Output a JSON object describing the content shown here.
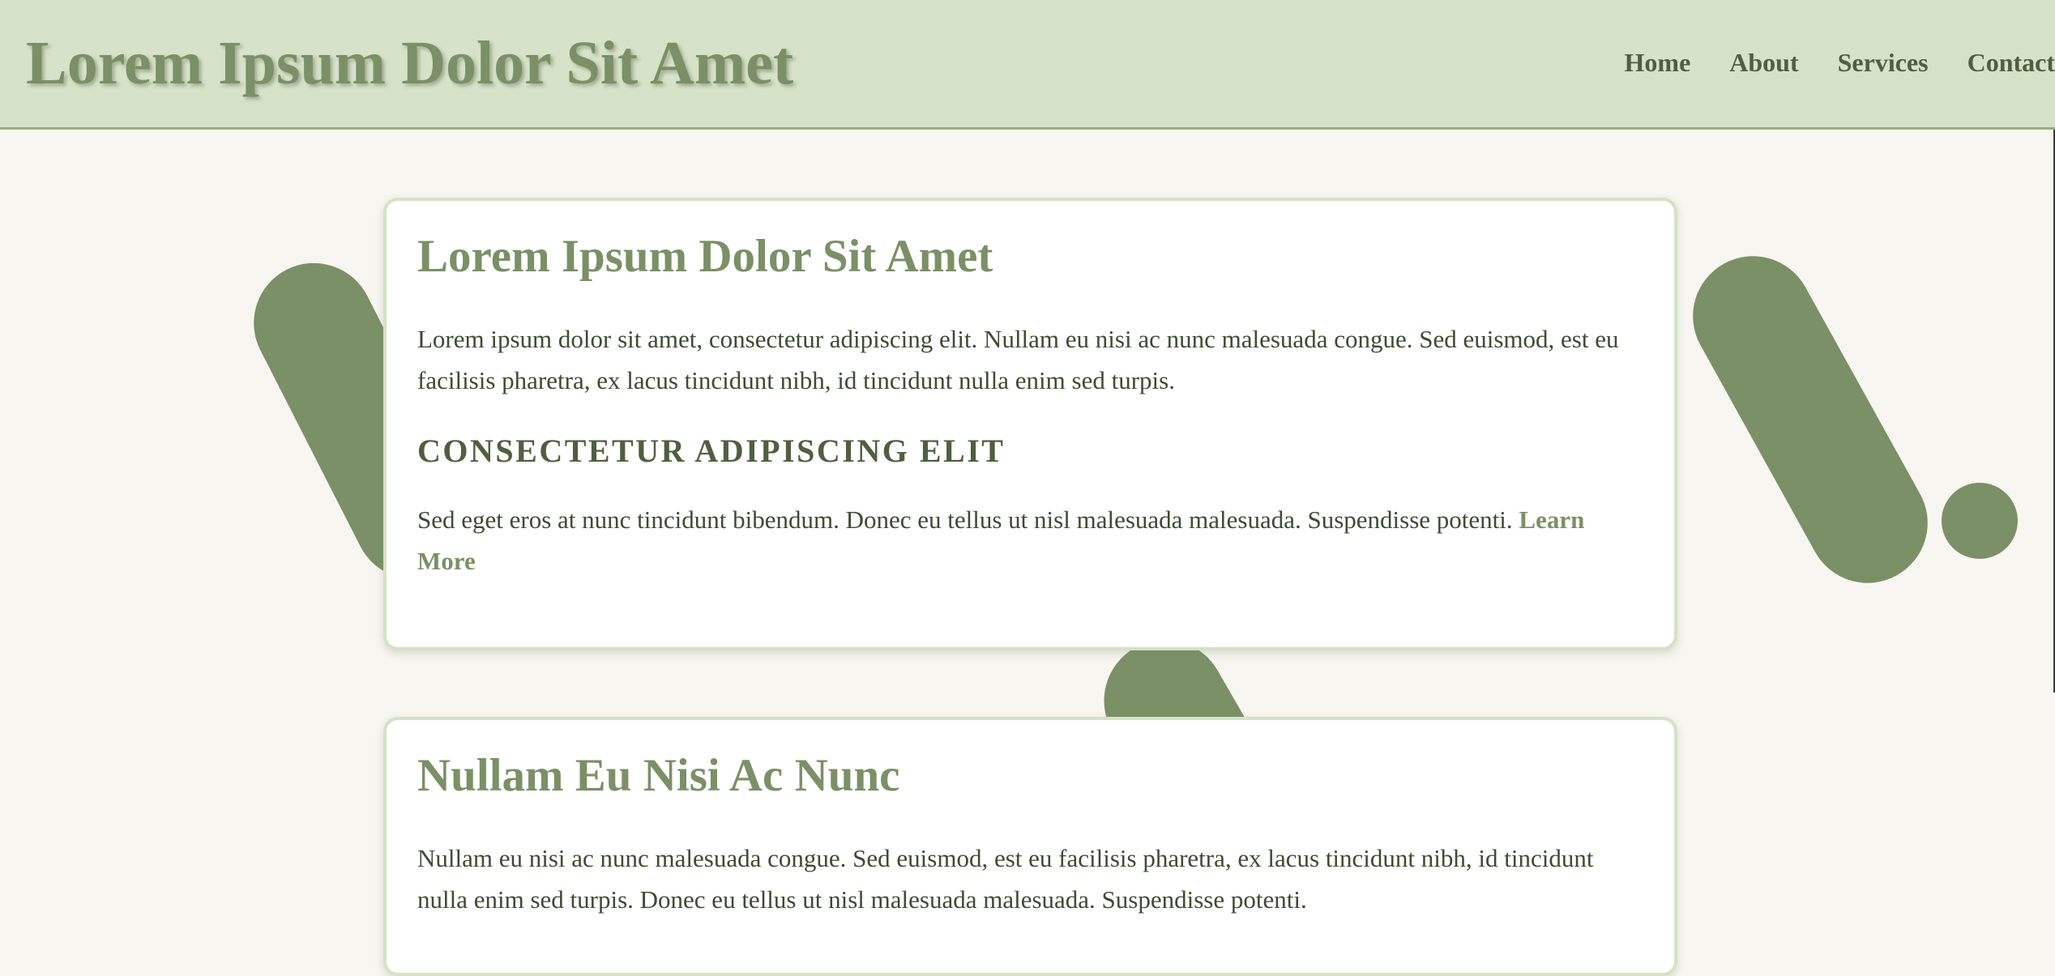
{
  "header": {
    "site_title": "Lorem Ipsum Dolor Sit Amet",
    "nav": [
      "Home",
      "About",
      "Services",
      "Contact"
    ]
  },
  "cards": [
    {
      "title": "Lorem Ipsum Dolor Sit Amet",
      "paragraph": "Lorem ipsum dolor sit amet, consectetur adipiscing elit. Nullam eu nisi ac nunc malesuada congue. Sed euismod, est eu facilisis pharetra, ex lacus tincidunt nibh, id tincidunt nulla enim sed turpis.",
      "subtitle": "CONSECTETUR ADIPISCING ELIT",
      "paragraph2": "Sed eget eros at nunc tincidunt bibendum. Donec eu tellus ut nisl malesuada malesuada. Suspendisse potenti.",
      "link": "Learn More"
    },
    {
      "title": "Nullam Eu Nisi Ac Nunc",
      "paragraph": "Nullam eu nisi ac nunc malesuada congue. Sed euismod, est eu facilisis pharetra, ex lacus tincidunt nibh, id tincidunt nulla enim sed turpis. Donec eu tellus ut nisl malesuada malesuada. Suspendisse potenti."
    }
  ],
  "colors": {
    "header_bg": "#d7e3c9",
    "accent": "#7b9066",
    "page_bg": "#f7f6f1",
    "text": "#3f4a33"
  }
}
